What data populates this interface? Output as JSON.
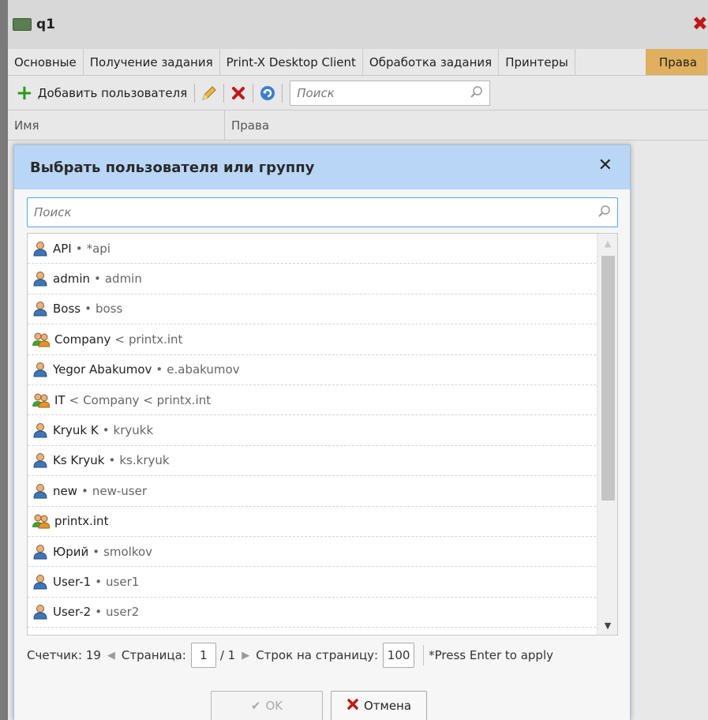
{
  "window": {
    "title": "q1",
    "tabs": [
      "Основные",
      "Получение задания",
      "Print-X Desktop Client",
      "Обработка задания",
      "Принтеры",
      "Права"
    ],
    "toolbar": {
      "add_user_label": "Добавить пользователя",
      "search_placeholder": "Поиск"
    },
    "grid": {
      "columns": [
        "Имя",
        "Права"
      ]
    }
  },
  "dialog": {
    "title": "Выбрать пользователя или группу",
    "search_placeholder": "Поиск",
    "items": [
      {
        "type": "user",
        "name": "API",
        "sep": "•",
        "detail": "*api"
      },
      {
        "type": "user",
        "name": "admin",
        "sep": "•",
        "detail": "admin"
      },
      {
        "type": "user",
        "name": "Boss",
        "sep": "•",
        "detail": "boss"
      },
      {
        "type": "group",
        "name": "Company",
        "sep": "<",
        "detail": "printx.int"
      },
      {
        "type": "user",
        "name": "Yegor Abakumov",
        "sep": "•",
        "detail": "e.abakumov"
      },
      {
        "type": "group",
        "name": "IT",
        "sep": "<",
        "detail": "Company < printx.int"
      },
      {
        "type": "user",
        "name": "Kryuk K",
        "sep": "•",
        "detail": "kryukk"
      },
      {
        "type": "user",
        "name": "Ks Kryuk",
        "sep": "•",
        "detail": "ks.kryuk"
      },
      {
        "type": "user",
        "name": "new",
        "sep": "•",
        "detail": "new-user"
      },
      {
        "type": "group",
        "name": "printx.int",
        "sep": "",
        "detail": ""
      },
      {
        "type": "user",
        "name": "Юрий",
        "sep": "•",
        "detail": "smolkov"
      },
      {
        "type": "user",
        "name": "User-1",
        "sep": "•",
        "detail": "user1"
      },
      {
        "type": "user",
        "name": "User-2",
        "sep": "•",
        "detail": "user2"
      }
    ],
    "pager": {
      "count_label": "Счетчик: 19",
      "page_label": "Страница:",
      "page_value": "1",
      "page_total": "/ 1",
      "rows_label": "Строк на страницу:",
      "rows_value": "100",
      "hint": "*Press Enter to apply"
    },
    "buttons": {
      "ok": "OK",
      "cancel": "Отмена"
    }
  },
  "icons": {
    "user": "user-icon",
    "group": "group-icon",
    "search": "search-icon",
    "close": "close-icon",
    "add": "plus-icon",
    "edit": "pencil-icon",
    "delete": "delete-icon",
    "refresh": "refresh-icon"
  },
  "colors": {
    "active_tab": "#e0b05e",
    "dialog_header": "#b9d6f7",
    "delete_red": "#c01818",
    "add_green": "#2c9a1c"
  }
}
